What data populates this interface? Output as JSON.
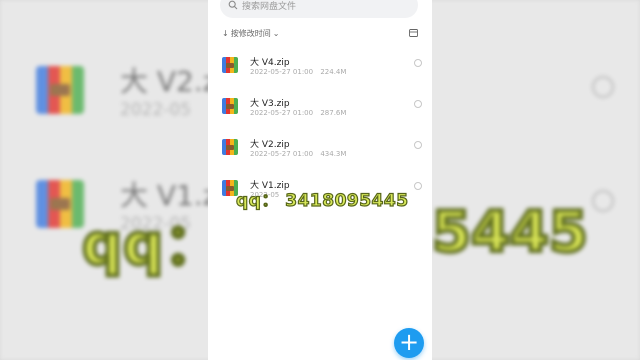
{
  "search": {
    "placeholder": "搜索网盘文件"
  },
  "sort": {
    "label": "按修改时间"
  },
  "files": [
    {
      "name": "大 V4.zip",
      "date": "2022-05-27 01:00",
      "size": "224.4M"
    },
    {
      "name": "大 V3.zip",
      "date": "2022-05-27 01:00",
      "size": "287.6M"
    },
    {
      "name": "大 V2.zip",
      "date": "2022-05-27 01:00",
      "size": "434.3M"
    },
    {
      "name": "大 V1.zip",
      "date": "2022-05"
    }
  ],
  "background": {
    "rows": [
      {
        "name": "大 V2.zip",
        "date": "2022-05"
      },
      {
        "name": "大 V1.zip",
        "date": "2022-05"
      }
    ],
    "watermark_left": "qq：",
    "watermark_right": "5445"
  },
  "fab": {
    "label": "+"
  },
  "watermark": "qq： 3418095445",
  "colors": {
    "accent": "#1e9cf0",
    "watermark": "#d9e95a"
  }
}
